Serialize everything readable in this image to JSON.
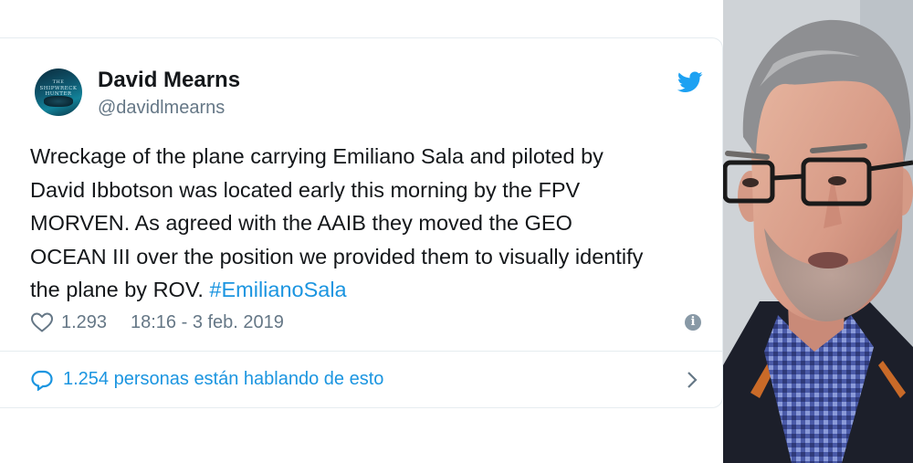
{
  "tweet": {
    "author_name": "David Mearns",
    "author_handle": "@davidlmearns",
    "avatar_text_top": "THE",
    "avatar_text_main": "SHIPWRECK HUNTER",
    "text_lines": [
      "Wreckage of the plane carrying Emiliano Sala and piloted by",
      "David Ibbotson was located early this morning by the FPV",
      "MORVEN. As agreed with the AAIB they moved the GEO",
      "OCEAN III over the position we provided them to visually identify",
      "the plane by ROV. "
    ],
    "hashtag": "#EmilianoSala",
    "likes": "1.293",
    "timestamp": "18:16 - 3 feb. 2019",
    "conversation": "1.254 personas están hablando de esto"
  },
  "colors": {
    "twitter_blue": "#1da1f2",
    "link_blue": "#1b95e0",
    "muted_gray": "#657786",
    "border": "#e6ecf0"
  },
  "icons": {
    "brand": "twitter-bird-icon",
    "like": "heart-icon",
    "info": "info-icon",
    "reply": "speech-bubble-icon",
    "chevron": "chevron-right-icon"
  },
  "photo": {
    "subject": "portrait"
  }
}
